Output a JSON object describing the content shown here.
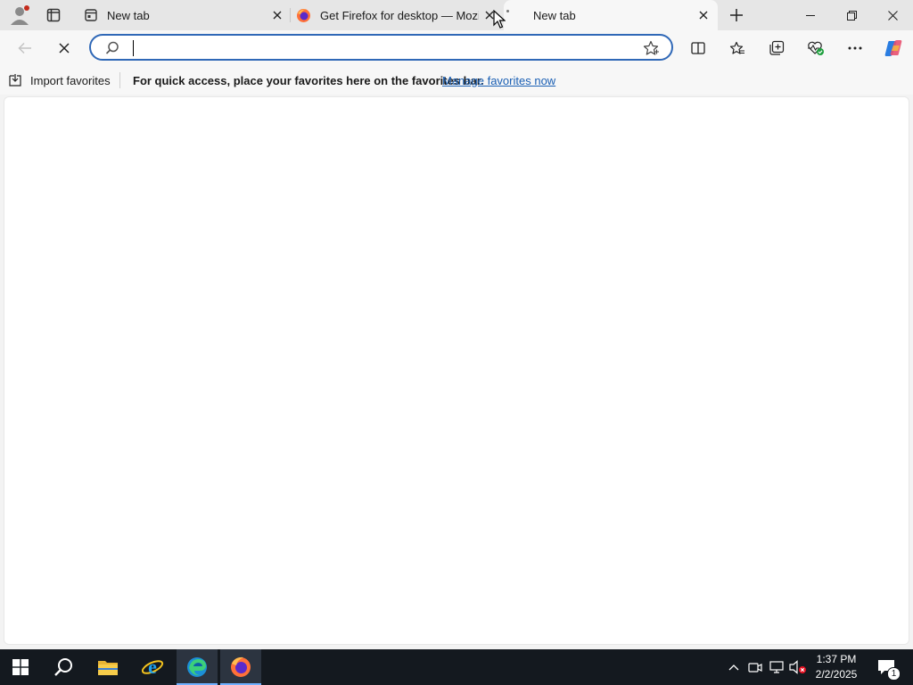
{
  "tabs": [
    {
      "title": "New tab",
      "active": false
    },
    {
      "title": "Get Firefox for desktop — Mozilla",
      "active": false
    },
    {
      "title": "New tab",
      "active": true
    }
  ],
  "address": {
    "value": "",
    "placeholder": ""
  },
  "favorites_bar": {
    "import_label": "Import favorites",
    "message": "For quick access, place your favorites here on the favorites bar.",
    "manage_link": "Manage favorites now"
  },
  "taskbar": {
    "time": "1:37 PM",
    "date": "2/2/2025",
    "notification_count": "1"
  },
  "colors": {
    "accent": "#2f68b7",
    "link": "#1a5fb4",
    "taskbar_bg": "#14191f",
    "active_indicator": "#6fb0ff"
  },
  "icons": [
    "profile-icon",
    "tab-actions-icon",
    "newtab-favicon",
    "firefox-favicon",
    "close-icon",
    "new-tab-plus-icon",
    "minimize-icon",
    "restore-icon",
    "window-close-icon",
    "back-arrow-icon",
    "stop-loading-icon",
    "search-icon",
    "star-icon",
    "split-screen-icon",
    "favorites-icon",
    "collections-icon",
    "browser-essentials-icon",
    "more-icon",
    "copilot-icon",
    "import-favorites-icon",
    "windows-start-icon",
    "taskbar-search-icon",
    "file-explorer-icon",
    "internet-explorer-icon",
    "edge-icon",
    "firefox-icon",
    "show-hidden-icons-chevron",
    "meet-now-icon",
    "network-icon",
    "volume-muted-icon",
    "notifications-icon"
  ]
}
